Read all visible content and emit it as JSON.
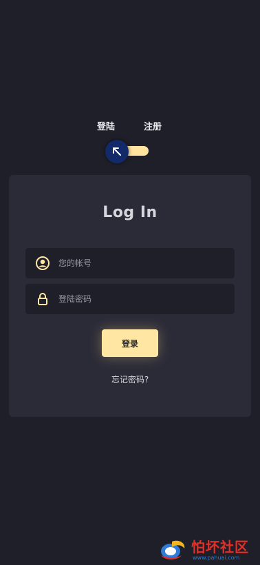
{
  "tabs": {
    "login_label": "登陆",
    "register_label": "注册"
  },
  "toggle": {
    "state": "login",
    "knob_icon": "arrow-up-left-icon",
    "track_color": "#ffe4a0",
    "knob_color": "#122a6a"
  },
  "card": {
    "title": "Log In",
    "account_field": {
      "placeholder": "您的帐号",
      "value": "",
      "icon": "user-icon"
    },
    "password_field": {
      "placeholder": "登陆密码",
      "value": "",
      "icon": "lock-icon"
    },
    "submit_label": "登录",
    "forgot_label": "忘记密码?"
  },
  "watermark": {
    "title": "怕坏社区",
    "url": "www.pahuai.com"
  },
  "colors": {
    "background": "#1f1f29",
    "card": "#2b2b38",
    "accent": "#ffe7a3"
  }
}
